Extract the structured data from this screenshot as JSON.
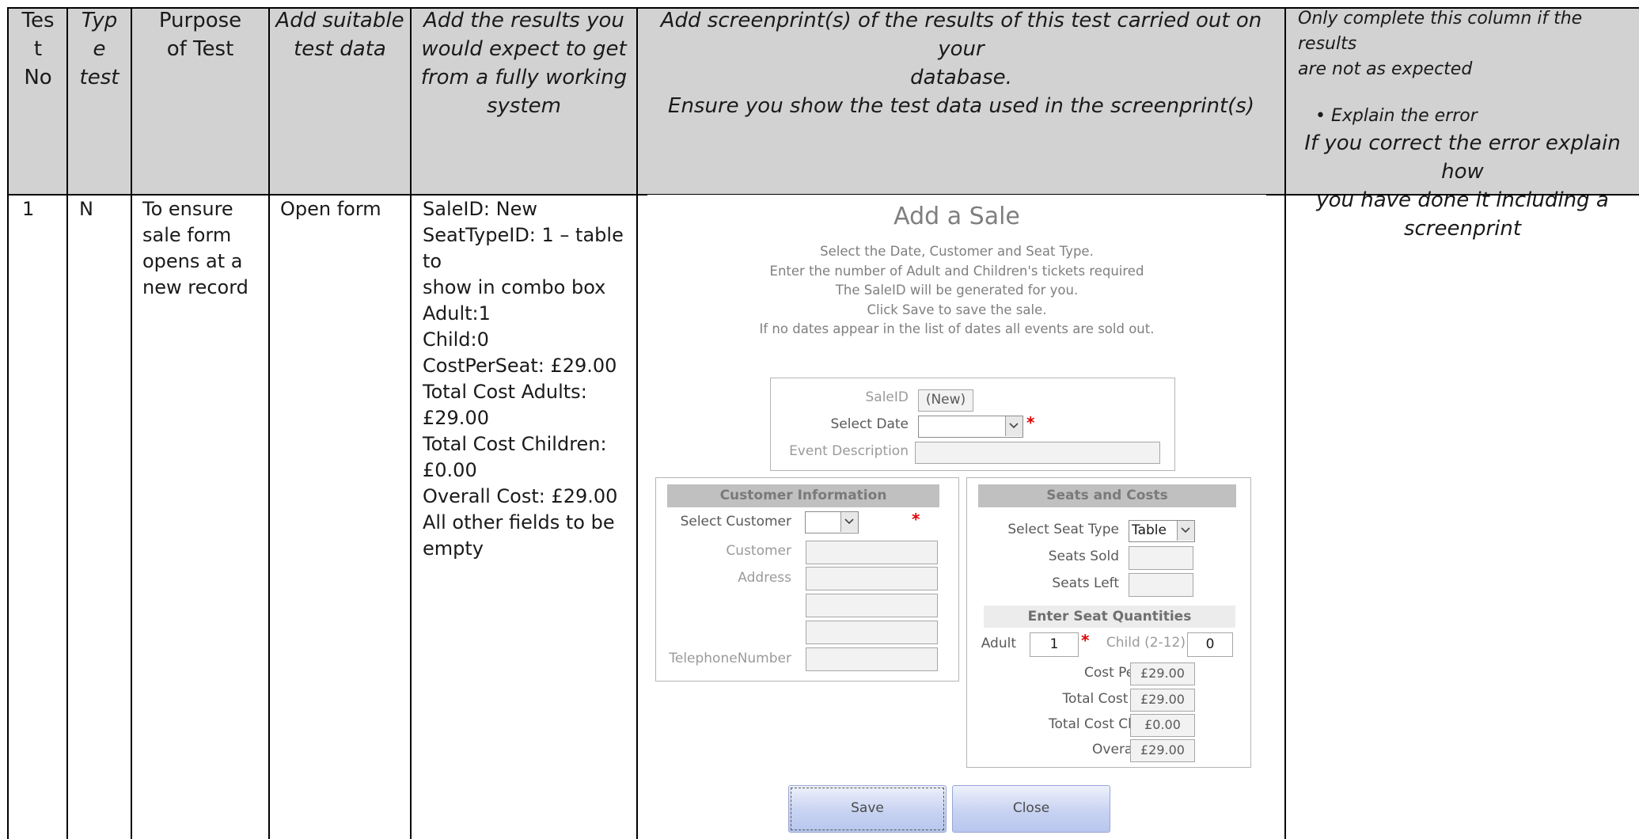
{
  "header": {
    "test_no": [
      "Tes",
      "t",
      "No"
    ],
    "type_test": [
      "Typ",
      "e",
      "test"
    ],
    "purpose": [
      "Purpose",
      "of Test"
    ],
    "test_data": [
      "Add suitable",
      "test data"
    ],
    "expected": [
      "Add the results you",
      "would expect to get",
      "from a fully working",
      "system"
    ],
    "screenprint": [
      "Add screenprint(s) of the results of this test carried out on your",
      "database.",
      "Ensure you show the test data used in the screenprint(s)"
    ],
    "errors_note": [
      "Only complete this column if the results",
      "are not as expected"
    ],
    "errors_bullet": "Explain the error",
    "errors_correct": [
      "If you correct the error explain how",
      "you have done it including a",
      "screenprint"
    ]
  },
  "row": {
    "test_no": "1",
    "type": "N",
    "purpose": [
      "To ensure",
      "sale form",
      "opens at a",
      "new record"
    ],
    "test_data": "Open form",
    "expected": [
      "SaleID: New",
      "SeatTypeID: 1 – table to",
      "show in combo box",
      "Adult:1",
      "Child:0",
      "CostPerSeat: £29.00",
      "Total Cost Adults:",
      "£29.00",
      "Total Cost Children:",
      "£0.00",
      "Overall Cost: £29.00",
      "All other fields to be",
      "empty"
    ]
  },
  "form": {
    "title": "Add a Sale",
    "instructions": [
      "Select the Date, Customer and Seat Type.",
      "Enter the number of Adult and Children's tickets required",
      "The SaleID will be generated for you.",
      "Click Save to save the sale.",
      "If no dates appear in the list of dates all events are sold out."
    ],
    "sale": {
      "saleid_label": "SaleID",
      "saleid_value": "(New)",
      "date_label": "Select Date",
      "event_label": "Event Description",
      "required_mark": "*"
    },
    "customer": {
      "header": "Customer Information",
      "select_label": "Select Customer",
      "customer_label": "Customer",
      "address_label": "Address",
      "phone_label": "TelephoneNumber"
    },
    "seats": {
      "header": "Seats and Costs",
      "seat_type_label": "Select Seat Type",
      "seat_type_value": "Table",
      "seats_sold_label": "Seats Sold",
      "seats_left_label": "Seats Left",
      "quantities_header": "Enter Seat Quantities",
      "adult_label": "Adult",
      "adult_value": "1",
      "child_label": "Child (2-12)",
      "child_value": "0",
      "cost_per_seat_label": "Cost Per Seat",
      "cost_per_seat_value": "£29.00",
      "total_adults_label": "Total Cost Adults",
      "total_adults_value": "£29.00",
      "total_children_label": "Total Cost Children",
      "total_children_value": "£0.00",
      "overall_label": "Overall Cost",
      "overall_value": "£29.00"
    },
    "buttons": {
      "save": "Save",
      "close": "Close"
    }
  }
}
